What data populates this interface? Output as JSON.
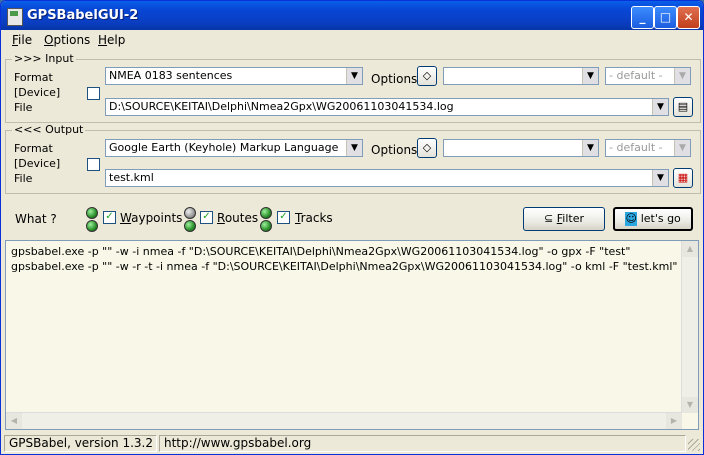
{
  "window": {
    "title": "GPSBabelGUI-2",
    "controls": [
      "_",
      "□",
      "✕"
    ]
  },
  "menu": [
    {
      "key": "F",
      "rest": "ile"
    },
    {
      "key": "O",
      "rest": "ptions"
    },
    {
      "key": "H",
      "rest": "elp"
    }
  ],
  "input": {
    "legend": ">>> Input",
    "format_label": "Format",
    "device_label": "[Device]",
    "file_label": "File",
    "format_value": "NMEA 0183 sentences",
    "options_label": "Options",
    "options_value": "",
    "default_value": "- default -",
    "file_value": "D:\\SOURCE\\KEITAI\\Delphi\\Nmea2Gpx\\WG20061103041534.log",
    "device_checked": false
  },
  "output": {
    "legend": "<<< Output",
    "format_label": "Format",
    "device_label": "[Device]",
    "file_label": "File",
    "format_value": "Google Earth (Keyhole) Markup Language",
    "options_label": "Options",
    "options_value": "",
    "default_value": "- default -",
    "file_value": "test.kml",
    "device_checked": false
  },
  "what": {
    "label": "What ?",
    "waypoints": {
      "key": "W",
      "rest": "aypoints",
      "checked": true
    },
    "routes": {
      "key": "R",
      "rest": "outes",
      "checked": true
    },
    "tracks": {
      "key": "T",
      "rest": "racks",
      "checked": true
    },
    "filter_key": "F",
    "filter_rest": "ilter",
    "go_label": "let's go"
  },
  "log": {
    "line1": "gpsbabel.exe -p \"\" -w -i nmea -f \"D:\\SOURCE\\KEITAI\\Delphi\\Nmea2Gpx\\WG20061103041534.log\" -o gpx -F \"test\"",
    "line2": "gpsbabel.exe -p \"\" -w -r -t -i nmea -f \"D:\\SOURCE\\KEITAI\\Delphi\\Nmea2Gpx\\WG20061103041534.log\" -o kml -F \"test.kml\""
  },
  "status": {
    "version": "GPSBabel, version 1.3.2",
    "url": "http://www.gpsbabel.org"
  },
  "colors": {
    "titlebar": "#0a5fe8",
    "log_bg": "#f9f8e8",
    "face": "#ece9d8"
  }
}
